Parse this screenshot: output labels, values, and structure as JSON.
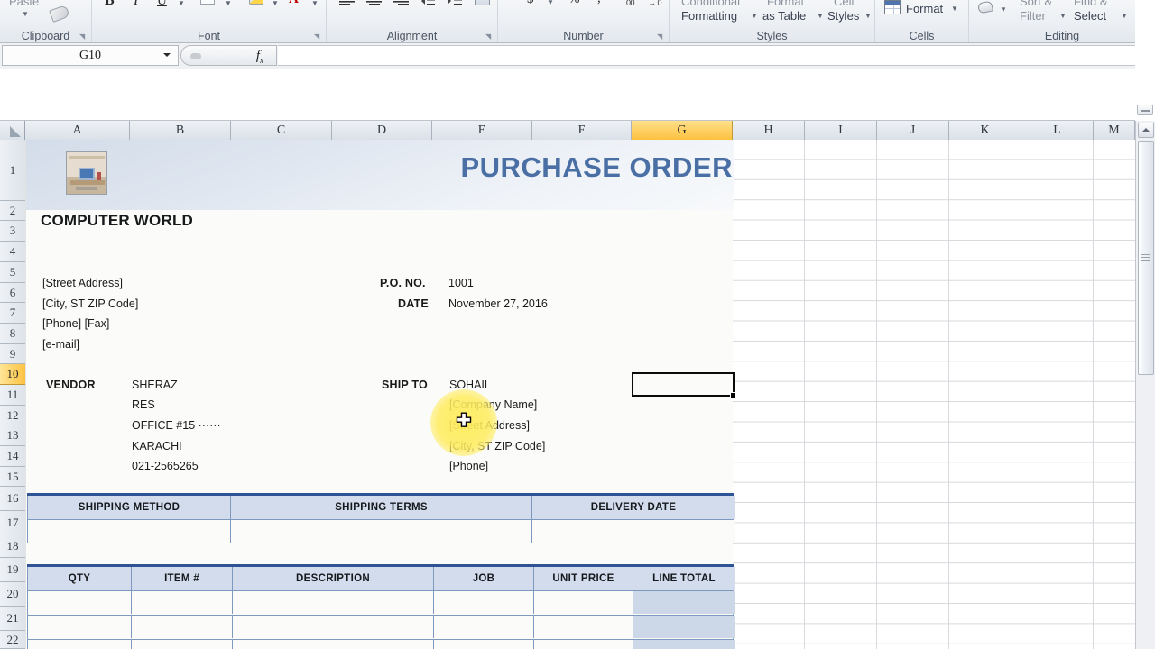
{
  "ribbon": {
    "groups": [
      {
        "name": "Clipboard",
        "label": "Clipboard"
      },
      {
        "name": "Font",
        "label": "Font"
      },
      {
        "name": "Alignment",
        "label": "Alignment"
      },
      {
        "name": "Number",
        "label": "Number"
      },
      {
        "name": "Styles",
        "label": "Styles"
      },
      {
        "name": "Cells",
        "label": "Cells"
      },
      {
        "name": "Editing",
        "label": "Editing"
      }
    ],
    "paste_label": "Paste",
    "conditional_formatting_line1": "Conditional",
    "conditional_formatting_line2": "Formatting",
    "format_as_table_line1": "Format",
    "format_as_table_line2": "as Table",
    "cell_styles_line1": "Cell",
    "cell_styles_line2": "Styles",
    "format_label": "Format",
    "sort_filter_line1": "Sort &",
    "sort_filter_line2": "Filter",
    "find_select_line1": "Find &",
    "find_select_line2": "Select"
  },
  "formula_bar": {
    "name_box_value": "G10",
    "formula_value": "",
    "fx_label": "fx"
  },
  "grid": {
    "columns": [
      "A",
      "B",
      "C",
      "D",
      "E",
      "F",
      "G",
      "H",
      "I",
      "J",
      "K",
      "L",
      "M"
    ],
    "selected_column": "G",
    "rows": [
      "1",
      "2",
      "3",
      "4",
      "5",
      "6",
      "7",
      "8",
      "9",
      "10",
      "11",
      "12",
      "13",
      "14",
      "15",
      "16",
      "17",
      "18",
      "19",
      "20",
      "21",
      "22"
    ],
    "selected_row": "10",
    "active_cell": "G10"
  },
  "purchase_order": {
    "title": "PURCHASE ORDER",
    "company_name": "COMPUTER WORLD",
    "logo_alt": "computer-desk-photo",
    "sender": {
      "street": "[Street Address]",
      "city_zip": "[City, ST  ZIP Code]",
      "phone_fax": "[Phone] [Fax]",
      "email": "[e-mail]"
    },
    "meta": {
      "po_no_label": "P.O. NO.",
      "po_no_value": "1001",
      "date_label": "DATE",
      "date_value": "November 27, 2016"
    },
    "vendor": {
      "label": "VENDOR",
      "lines": [
        "SHERAZ",
        "RES",
        "OFFICE #15 ······",
        "KARACHI",
        "021-2565265"
      ]
    },
    "ship_to": {
      "label": "SHIP TO",
      "lines": [
        "SOHAIL",
        "[Company Name]",
        "[Street Address]",
        "[City, ST  ZIP Code]",
        "[Phone]"
      ]
    },
    "shipping_table": {
      "headers": [
        "SHIPPING METHOD",
        "SHIPPING TERMS",
        "DELIVERY DATE"
      ],
      "rows": [
        [
          "",
          "",
          ""
        ]
      ]
    },
    "items_table": {
      "headers": [
        "QTY",
        "ITEM #",
        "DESCRIPTION",
        "JOB",
        "UNIT PRICE",
        "LINE TOTAL"
      ],
      "rows": [
        [
          "",
          "",
          "",
          "",
          "",
          ""
        ],
        [
          "",
          "",
          "",
          "",
          "",
          ""
        ],
        [
          "",
          "",
          "",
          "",
          "",
          ""
        ]
      ]
    }
  },
  "colors": {
    "title_blue": "#4a6fa5",
    "table_header_fill": "#d3dcec",
    "table_border": "#7e99c0",
    "selection_yellow": "#fcc13f",
    "shaded_column": "#ccd7e8",
    "click_highlight": "#ffec5c"
  }
}
